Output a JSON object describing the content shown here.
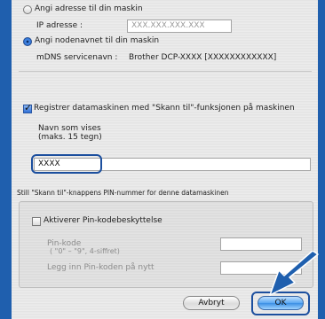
{
  "address_option": {
    "label": "Angi adresse til din maskin"
  },
  "ip": {
    "label": "IP adresse :",
    "placeholder": "XXX.XXX.XXX.XXX"
  },
  "node_option": {
    "label": "Angi nodenavnet til din maskin"
  },
  "mdns": {
    "label": "mDNS servicenavn :",
    "value": "Brother DCP-XXXX [XXXXXXXXXXXX]"
  },
  "register": {
    "label": "Registrer datamaskinen med \"Skann til\"-funksjonen på maskinen"
  },
  "display_name": {
    "label_line1": "Navn som vises",
    "label_line2": "(maks. 15 tegn)",
    "value": "XXXX"
  },
  "pin_section_title": "Still \"Skann til\"-knappens PIN-nummer for denne datamaskinen",
  "pin_protect": {
    "label": "Aktiverer Pin-kodebeskyttelse"
  },
  "pin_code": {
    "label_line1": "Pin-kode",
    "label_line2": "( \"0\" – \"9\", 4-siffret)"
  },
  "pin_repeat": {
    "label": "Legg inn Pin-koden på nytt"
  },
  "buttons": {
    "cancel": "Avbryt",
    "ok": "OK"
  },
  "colors": {
    "accent": "#1c4f9e",
    "background": "#1f5fae",
    "arrow": "#1f5fae"
  }
}
